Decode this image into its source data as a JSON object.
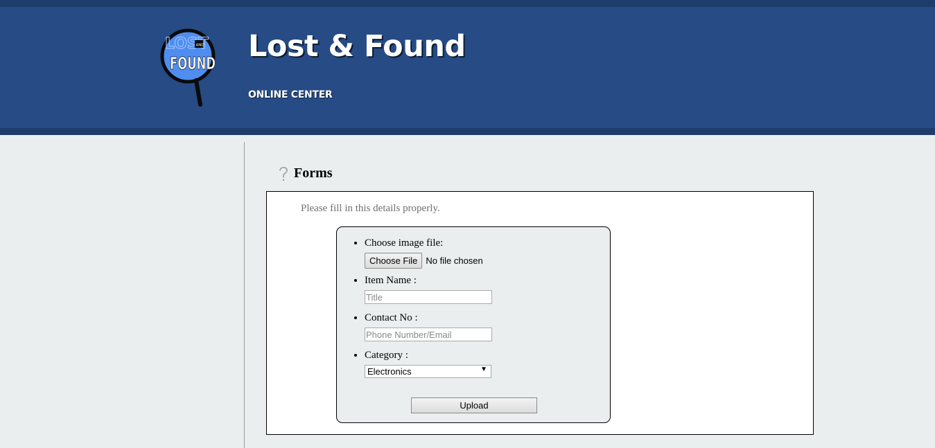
{
  "header": {
    "title": "Lost & Found",
    "subtitle": "ONLINE CENTER",
    "logo_text_top": "LOST",
    "logo_text_small": "AND",
    "logo_text_bottom": "FOUND"
  },
  "section": {
    "title": "Forms",
    "icon": "question-mark-icon"
  },
  "form": {
    "intro": "Please fill in this details properly.",
    "image_label": "Choose image file:",
    "choose_file_button": "Choose File",
    "file_status": "No file chosen",
    "item_name_label": "Item Name :",
    "item_name_placeholder": "Title",
    "contact_label": "Contact No :",
    "contact_placeholder": "Phone Number/Email",
    "category_label": "Category :",
    "category_selected": "Electronics",
    "upload_button": "Upload"
  },
  "colors": {
    "header_bg": "#264b85",
    "header_strip": "#1f3d6b",
    "page_bg": "#eaeeee"
  }
}
